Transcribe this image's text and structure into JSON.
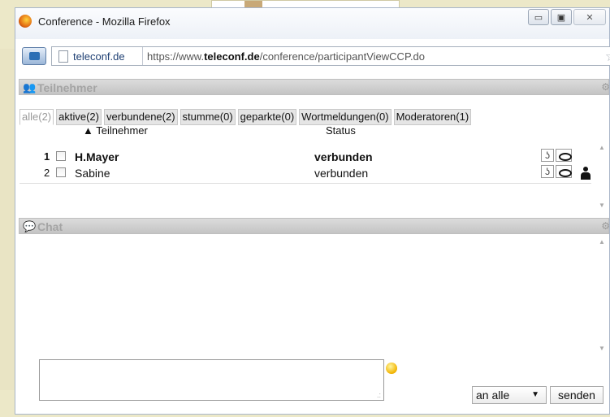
{
  "browser": {
    "window_title": "Conference - Mozilla Firefox",
    "controls": {
      "minimize": "▭",
      "maximize": "▣",
      "close": "✕"
    },
    "domain_label": "teleconf.de",
    "url_prefix": "https://www.",
    "url_host": "teleconf.de",
    "url_path": "/conference/participantViewCCP.do"
  },
  "participants_panel": {
    "title": "Teilnehmer",
    "tabs": [
      {
        "label": "alle(2)",
        "active": true
      },
      {
        "label": "aktive(2)"
      },
      {
        "label": "verbundene(2)"
      },
      {
        "label": "stumme(0)"
      },
      {
        "label": "geparkte(0)"
      },
      {
        "label": "Wortmeldungen(0)"
      },
      {
        "label": "Moderatoren(1)"
      }
    ],
    "columns": {
      "name": "▲ Teilnehmer",
      "status": "Status"
    },
    "rows": [
      {
        "num": "1",
        "name": "H.Mayer",
        "status": "verbunden",
        "bold": true,
        "moderator": false
      },
      {
        "num": "2",
        "name": "Sabine",
        "status": "verbunden",
        "bold": false,
        "moderator": true
      }
    ],
    "ear_glyph": "ʖ"
  },
  "chat_panel": {
    "title": "Chat",
    "input_value": "",
    "recipient": "an alle",
    "send_label": "senden"
  },
  "icons": {
    "users": "people-icon",
    "chat": "chat-bubbles-icon",
    "star": "bookmark-star-icon"
  }
}
